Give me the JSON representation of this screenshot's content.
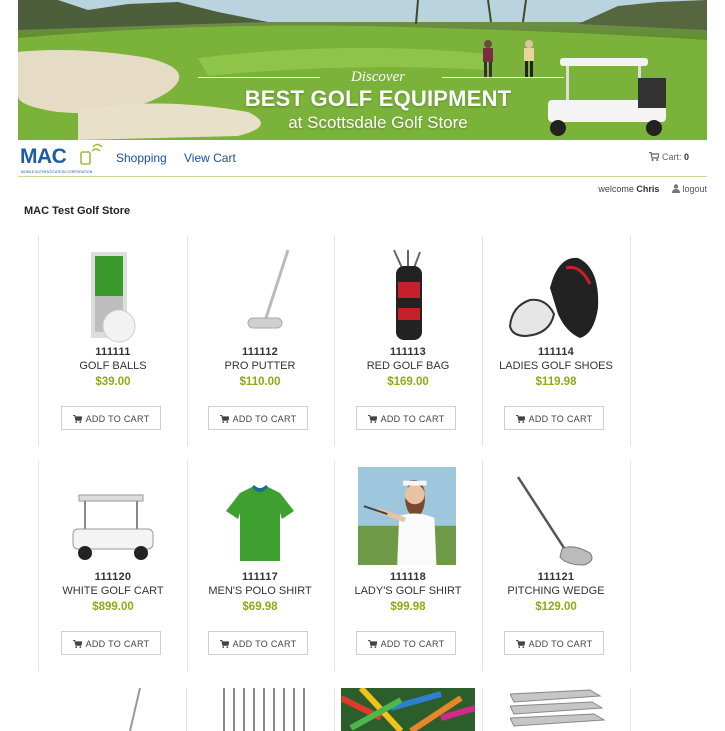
{
  "banner": {
    "discover": "Discover",
    "headline": "BEST GOLF EQUIPMENT",
    "subline": "at Scottsdale Golf Store"
  },
  "logo": {
    "text": "MAC",
    "tagline": "MOBILE AUTHENTICATION CORPORATION"
  },
  "nav": {
    "shopping": "Shopping",
    "view_cart": "View Cart",
    "cart_label": "Cart:",
    "cart_count": "0"
  },
  "user": {
    "welcome": "welcome",
    "name": "Chris",
    "logout": "logout"
  },
  "store_title": "MAC Test Golf Store",
  "add_to_cart_label": "ADD TO CART",
  "products": [
    {
      "id": "111111",
      "name": "GOLF BALLS",
      "price": "$39.00",
      "icon": "golf-balls"
    },
    {
      "id": "111112",
      "name": "PRO PUTTER",
      "price": "$110.00",
      "icon": "putter"
    },
    {
      "id": "111113",
      "name": "RED GOLF BAG",
      "price": "$169.00",
      "icon": "golf-bag"
    },
    {
      "id": "111114",
      "name": "LADIES GOLF SHOES",
      "price": "$119.98",
      "icon": "golf-shoes"
    },
    {
      "id": "111120",
      "name": "WHITE GOLF CART",
      "price": "$899.00",
      "icon": "golf-cart"
    },
    {
      "id": "111117",
      "name": "MEN'S POLO SHIRT",
      "price": "$69.98",
      "icon": "polo-shirt"
    },
    {
      "id": "111118",
      "name": "LADY'S GOLF SHIRT",
      "price": "$99.98",
      "icon": "golfer-photo"
    },
    {
      "id": "111121",
      "name": "PITCHING WEDGE",
      "price": "$129.00",
      "icon": "wedge"
    }
  ],
  "colors": {
    "price": "#8dab12",
    "link": "#1d4f9a",
    "logo": "#1e5aa8"
  }
}
